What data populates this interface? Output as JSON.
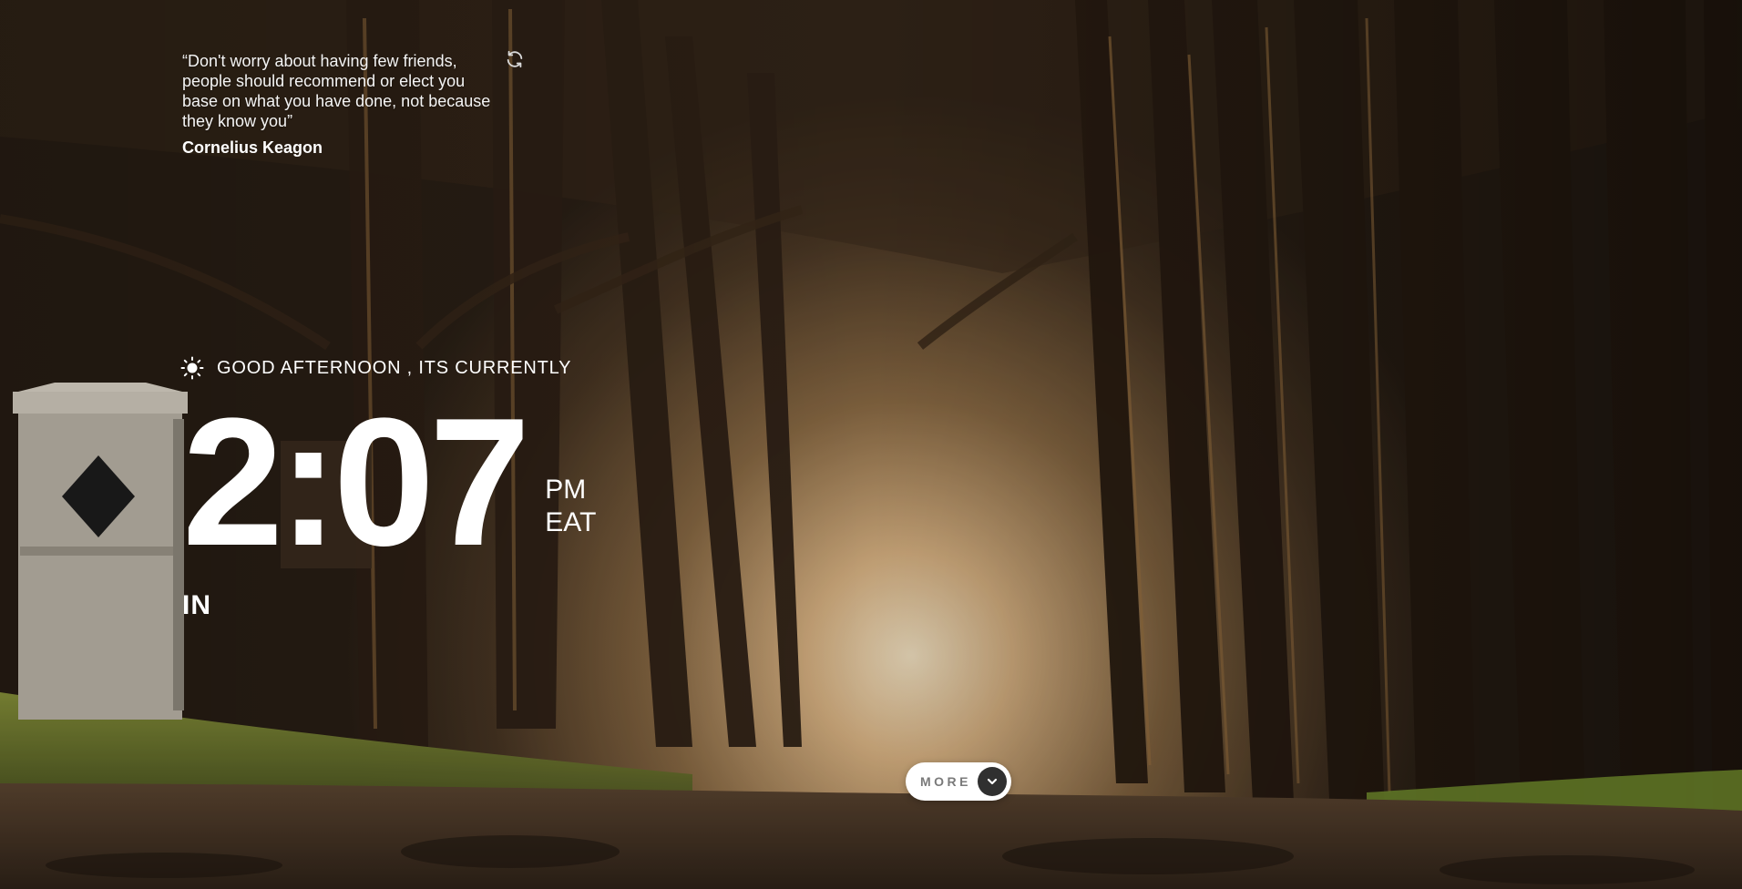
{
  "quote": {
    "text": "“Don't worry about having few friends, people should recommend or elect you base on what you have done, not because they know you”",
    "author": "Cornelius Keagon"
  },
  "greeting": {
    "icon": "sun-icon",
    "text": "GOOD AFTERNOON , ITS CURRENTLY"
  },
  "clock": {
    "time": "2:07",
    "period": "PM",
    "timezone": "EAT"
  },
  "location": {
    "text": "IN"
  },
  "more_button": {
    "label": "MORE",
    "icon": "chevron-down-icon"
  },
  "colors": {
    "text": "#ffffff",
    "button_bg": "#ffffff",
    "button_label": "#7a7a7a",
    "chevron_bg": "#303030"
  }
}
